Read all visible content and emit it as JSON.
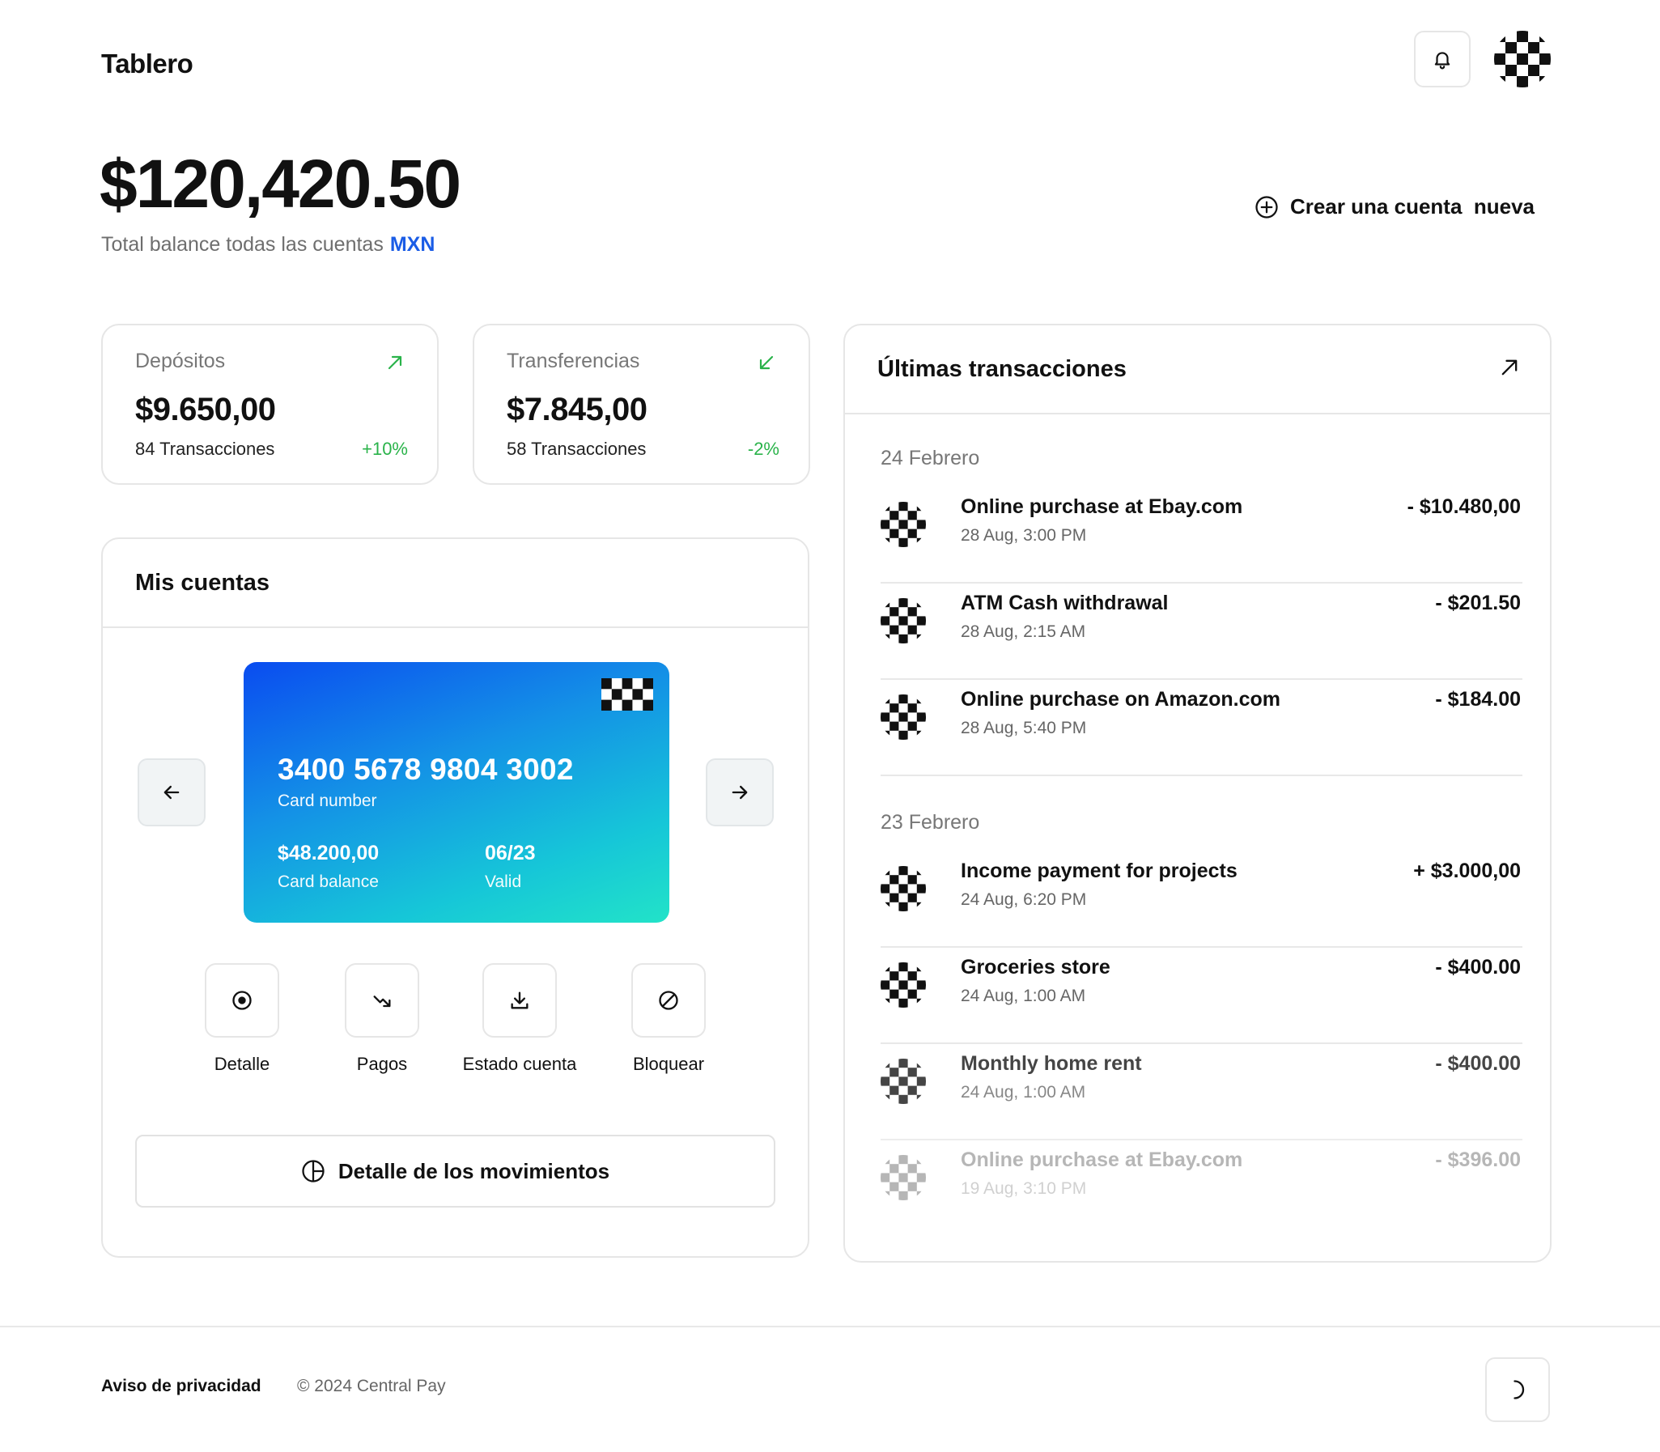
{
  "header": {
    "title": "Tablero",
    "notifications_icon": "bell-icon",
    "avatar_icon": "checkered-avatar"
  },
  "balance": {
    "amount": "$120,420.50",
    "label": "Total balance todas las cuentas",
    "currency": "MXN",
    "currency_color": "#1a5ce6"
  },
  "create_account": {
    "label": "Crear una cuenta  nueva",
    "icon": "plus-circle-icon"
  },
  "stats": [
    {
      "label": "Depósitos",
      "value": "$9.650,00",
      "count": "84 Transacciones",
      "change": "+10%",
      "arrow_icon": "arrow-up-right-icon",
      "color": "#2ab34a"
    },
    {
      "label": "Transferencias",
      "value": "$7.845,00",
      "count": "58 Transacciones",
      "change": "-2%",
      "arrow_icon": "arrow-down-left-icon",
      "color": "#2ab34a"
    }
  ],
  "accounts": {
    "title": "Mis cuentas",
    "card": {
      "number": "3400 5678 9804 3002",
      "number_label": "Card number",
      "balance": "$48.200,00",
      "balance_label": "Card balance",
      "valid": "06/23",
      "valid_label": "Valid",
      "gradient": [
        "#0a4cf0",
        "#22e3c8"
      ]
    },
    "actions": [
      {
        "label": "Detalle",
        "icon": "target-icon"
      },
      {
        "label": "Pagos",
        "icon": "trend-down-arrow-icon"
      },
      {
        "label": "Estado cuenta",
        "icon": "download-icon"
      },
      {
        "label": "Bloquear",
        "icon": "block-icon"
      }
    ],
    "movements_button": "Detalle de los movimientos",
    "movements_icon": "pie-chart-icon"
  },
  "transactions": {
    "title": "Últimas transacciones",
    "groups": [
      {
        "date": "24 Febrero",
        "items": [
          {
            "name": "Online purchase at Ebay.com",
            "time": "28 Aug, 3:00 PM",
            "amount": "- $10.480,00"
          },
          {
            "name": "ATM Cash withdrawal",
            "time": "28 Aug, 2:15 AM",
            "amount": "- $201.50"
          },
          {
            "name": "Online purchase on Amazon.com",
            "time": "28 Aug, 5:40 PM",
            "amount": "- $184.00"
          }
        ]
      },
      {
        "date": "23 Febrero",
        "items": [
          {
            "name": "Income payment for projects",
            "time": "24 Aug, 6:20 PM",
            "amount": "+ $3.000,00"
          },
          {
            "name": "Groceries store",
            "time": "24 Aug, 1:00 AM",
            "amount": "- $400.00"
          },
          {
            "name": "Monthly home rent",
            "time": "24 Aug, 1:00 AM",
            "amount": "- $400.00"
          },
          {
            "name": "Online purchase at Ebay.com",
            "time": "19 Aug, 3:10 PM",
            "amount": "- $396.00"
          }
        ]
      }
    ]
  },
  "footer": {
    "privacy": "Aviso de privacidad",
    "copyright": "© 2024 Central Pay",
    "theme_icon": "moon-icon"
  }
}
